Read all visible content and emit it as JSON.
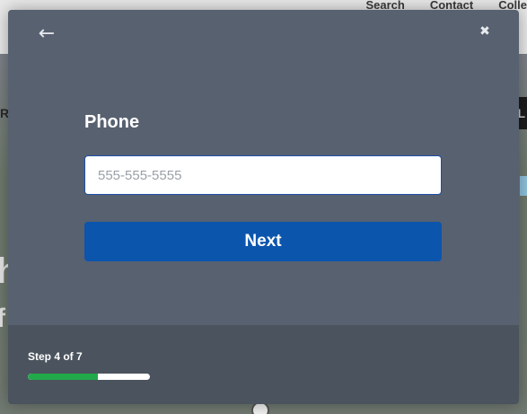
{
  "background": {
    "nav_items": [
      "Search",
      "Contact",
      "Colle"
    ],
    "left_letter": "R",
    "right_letters": "PL",
    "big_left_1": "h",
    "big_left_2": "f"
  },
  "modal": {
    "back_icon": "arrow-left-icon",
    "back_glyph": "←",
    "close_icon": "close-icon",
    "close_glyph": "✖",
    "field_label": "Phone",
    "phone_placeholder": "555-555-5555",
    "phone_value": "",
    "next_label": "Next",
    "step_text": "Step 4 of 7",
    "progress": {
      "current": 4,
      "total": 7,
      "fraction": 0.571
    },
    "colors": {
      "modal_bg": "#586170",
      "footer_bg": "#4b535e",
      "button_bg": "#0b55ad",
      "progress_fill": "#22a94a",
      "progress_track": "#ffffff"
    }
  }
}
